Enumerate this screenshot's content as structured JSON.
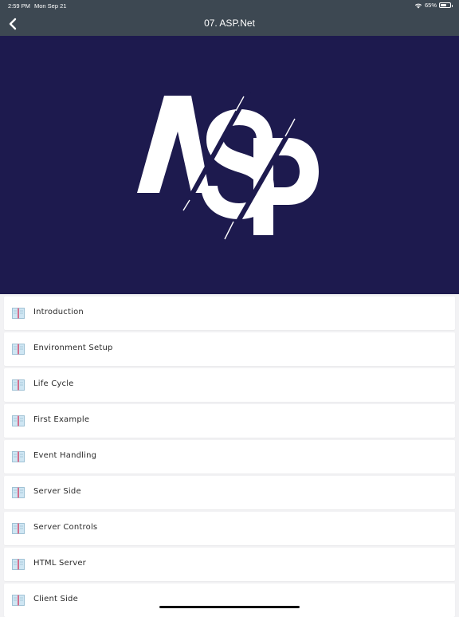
{
  "status_bar": {
    "time": "2:59 PM",
    "date": "Mon Sep 21",
    "battery_text": "65%",
    "battery_level": 0.65
  },
  "nav": {
    "title": "07. ASP.Net"
  },
  "hero": {
    "logo_text": "ASP",
    "background_color": "#1d1a4e",
    "logo_color": "#ffffff"
  },
  "topics": [
    {
      "label": "Introduction"
    },
    {
      "label": "Environment Setup"
    },
    {
      "label": "Life Cycle"
    },
    {
      "label": "First Example"
    },
    {
      "label": "Event Handling"
    },
    {
      "label": "Server Side"
    },
    {
      "label": "Server Controls"
    },
    {
      "label": "HTML Server"
    },
    {
      "label": "Client Side"
    }
  ],
  "icons": {
    "topic": "book-icon",
    "back": "chevron-left-icon"
  }
}
